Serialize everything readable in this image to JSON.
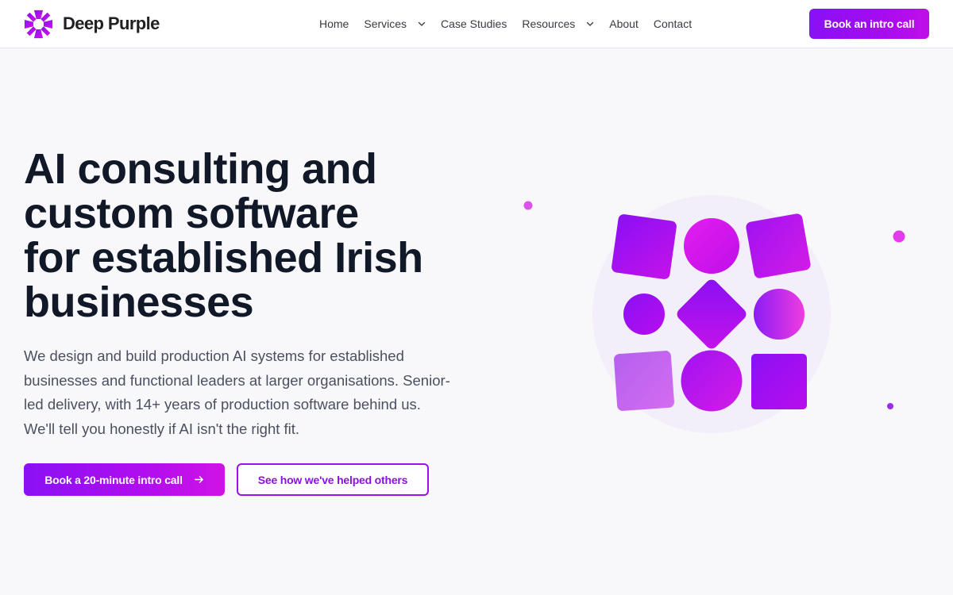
{
  "brand": {
    "name": "Deep Purple",
    "accent": "#9b10ee"
  },
  "nav": {
    "items": [
      {
        "label": "Home"
      },
      {
        "label": "Services"
      },
      {
        "label": "Case Studies"
      },
      {
        "label": "Resources"
      },
      {
        "label": "About"
      },
      {
        "label": "Contact"
      }
    ],
    "cta_label": "Book an intro call"
  },
  "hero": {
    "title_lines": [
      "AI consulting and",
      "custom software",
      "for established Irish",
      "businesses"
    ],
    "body_lines": [
      "We design and build production AI systems for established",
      "businesses and functional leaders at larger organisations. Senior-",
      "led delivery, with 14+ years of production software behind us.",
      "We'll tell you honestly if AI isn't the right fit."
    ],
    "primary_cta": "Book a 20-minute intro call",
    "secondary_cta": "See how we've helped others"
  },
  "icons": {
    "logo": "brand-asterisk-icon",
    "caret": "chevron-down-icon",
    "arrow": "arrow-right-icon"
  },
  "colors": {
    "text_dark": "#111827",
    "text_body": "#4b5060",
    "purple": "#8a10f5",
    "magenta": "#d012e6",
    "background": "#f8f8fa"
  }
}
